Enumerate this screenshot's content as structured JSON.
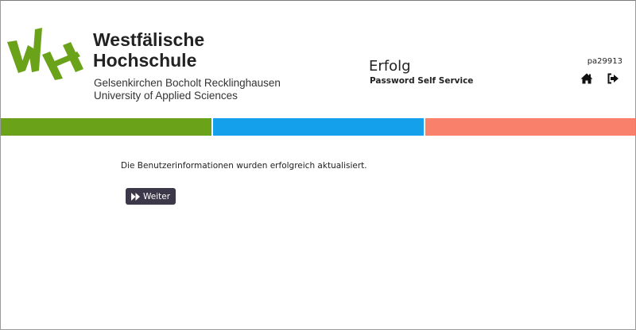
{
  "header": {
    "brand_line1": "Westfälische",
    "brand_line2": "Hochschule",
    "brand_sub1": "Gelsenkirchen Bocholt Recklinghausen",
    "brand_sub2": "University of Applied Sciences",
    "logo_text": "WH",
    "title": "Erfolg",
    "subtitle": "Password Self Service",
    "username": "pa29913",
    "home_icon": "home-icon",
    "logout_icon": "logout-icon"
  },
  "stripes": {
    "green": "#6aa31a",
    "blue": "#14a0ea",
    "salmon": "#f9806a"
  },
  "main": {
    "message": "Die Benutzerinformationen wurden erfolgreich aktualisiert.",
    "continue_label": "Weiter",
    "continue_icon": "fast-forward-icon",
    "button_color": "#3d3849"
  },
  "colors": {
    "logo_green": "#6aa31a"
  }
}
